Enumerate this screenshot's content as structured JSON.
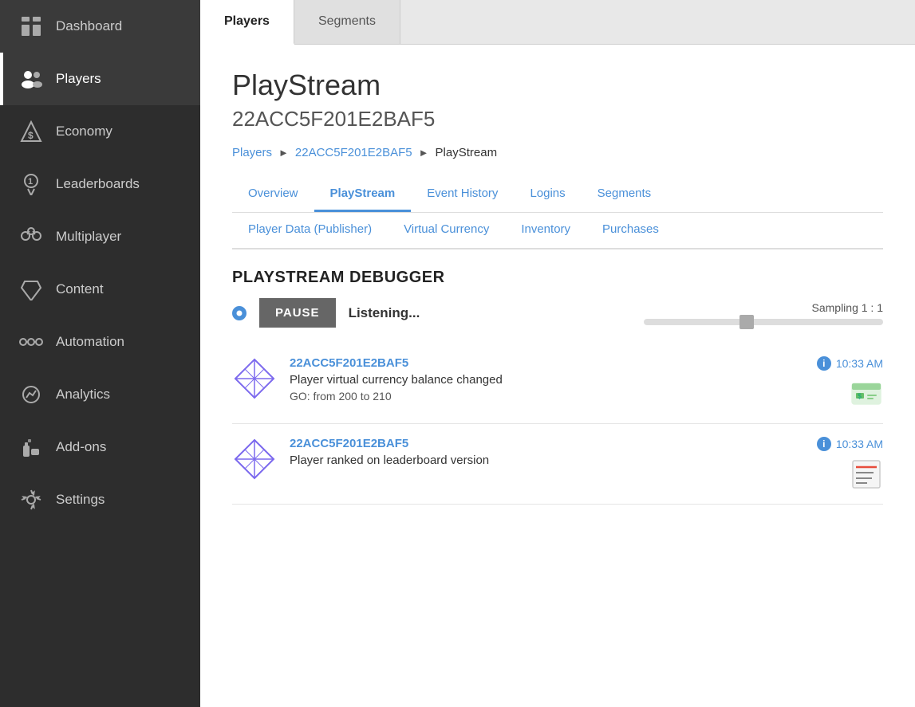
{
  "sidebar": {
    "items": [
      {
        "id": "dashboard",
        "label": "Dashboard",
        "icon": "dashboard-icon"
      },
      {
        "id": "players",
        "label": "Players",
        "icon": "players-icon",
        "active": true
      },
      {
        "id": "economy",
        "label": "Economy",
        "icon": "economy-icon"
      },
      {
        "id": "leaderboards",
        "label": "Leaderboards",
        "icon": "leaderboards-icon"
      },
      {
        "id": "multiplayer",
        "label": "Multiplayer",
        "icon": "multiplayer-icon"
      },
      {
        "id": "content",
        "label": "Content",
        "icon": "content-icon"
      },
      {
        "id": "automation",
        "label": "Automation",
        "icon": "automation-icon"
      },
      {
        "id": "analytics",
        "label": "Analytics",
        "icon": "analytics-icon"
      },
      {
        "id": "addons",
        "label": "Add-ons",
        "icon": "addons-icon"
      },
      {
        "id": "settings",
        "label": "Settings",
        "icon": "settings-icon"
      }
    ]
  },
  "topTabs": {
    "tabs": [
      {
        "id": "players",
        "label": "Players",
        "active": true
      },
      {
        "id": "segments",
        "label": "Segments",
        "active": false
      }
    ]
  },
  "header": {
    "title": "PlayStream",
    "playerId": "22ACC5F201E2BAF5"
  },
  "breadcrumb": {
    "items": [
      {
        "label": "Players",
        "link": true
      },
      {
        "label": "22ACC5F201E2BAF5",
        "link": true
      },
      {
        "label": "PlayStream",
        "link": false
      }
    ]
  },
  "navTabs": {
    "row1": [
      {
        "id": "overview",
        "label": "Overview",
        "active": false
      },
      {
        "id": "playstream",
        "label": "PlayStream",
        "active": true
      },
      {
        "id": "event-history",
        "label": "Event History",
        "active": false
      },
      {
        "id": "logins",
        "label": "Logins",
        "active": false
      },
      {
        "id": "segments",
        "label": "Segments",
        "active": false
      }
    ],
    "row2": [
      {
        "id": "player-data",
        "label": "Player Data (Publisher)",
        "active": false
      },
      {
        "id": "virtual-currency",
        "label": "Virtual Currency",
        "active": false
      },
      {
        "id": "inventory",
        "label": "Inventory",
        "active": false
      },
      {
        "id": "purchases",
        "label": "Purchases",
        "active": false
      }
    ]
  },
  "debugger": {
    "title": "PLAYSTREAM DEBUGGER",
    "samplingLabel": "Sampling 1 : 1",
    "pauseLabel": "PAUSE",
    "listeningLabel": "Listening...",
    "events": [
      {
        "id": "evt1",
        "playerId": "22ACC5F201E2BAF5",
        "description": "Player virtual currency balance changed",
        "detail": "GO: from 200 to 210",
        "time": "10:33 AM",
        "iconType": "currency"
      },
      {
        "id": "evt2",
        "playerId": "22ACC5F201E2BAF5",
        "description": "Player ranked on leaderboard version",
        "detail": "",
        "time": "10:33 AM",
        "iconType": "leaderboard"
      }
    ]
  },
  "colors": {
    "accent": "#4a90d9",
    "sidebar_bg": "#2d2d2d",
    "active_sidebar": "#3a3a3a"
  }
}
